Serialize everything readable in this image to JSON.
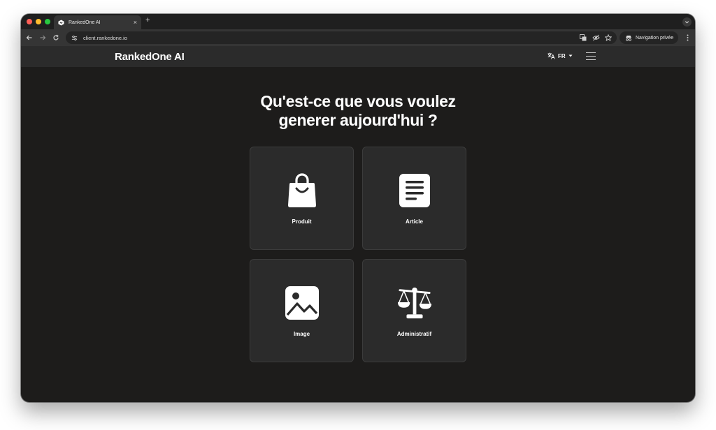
{
  "browser": {
    "tab_title": "RankedOne AI",
    "tab_close": "×",
    "new_tab": "+",
    "url": "client.rankedone.io",
    "private_label": "Navigation privée",
    "icons": [
      "back-icon",
      "forward-icon",
      "reload-icon",
      "site-info-icon",
      "translate-icon",
      "eye-off-icon",
      "star-icon",
      "incognito-icon",
      "kebab-menu-icon",
      "tab-search-icon"
    ]
  },
  "header": {
    "brand": "RankedOne AI",
    "language": "FR",
    "icons": [
      "translate-icon",
      "caret-down-icon",
      "hamburger-icon"
    ]
  },
  "main": {
    "heading_line1": "Qu'est-ce que vous voulez",
    "heading_line2": "generer aujourd'hui ?",
    "cards": [
      {
        "label": "Produit",
        "icon": "shopping-bag-icon"
      },
      {
        "label": "Article",
        "icon": "document-icon"
      },
      {
        "label": "Image",
        "icon": "image-icon"
      },
      {
        "label": "Administratif",
        "icon": "scales-icon"
      }
    ]
  },
  "colors": {
    "background": "#1d1c1b",
    "card": "#2b2b2b",
    "text": "#ffffff"
  }
}
